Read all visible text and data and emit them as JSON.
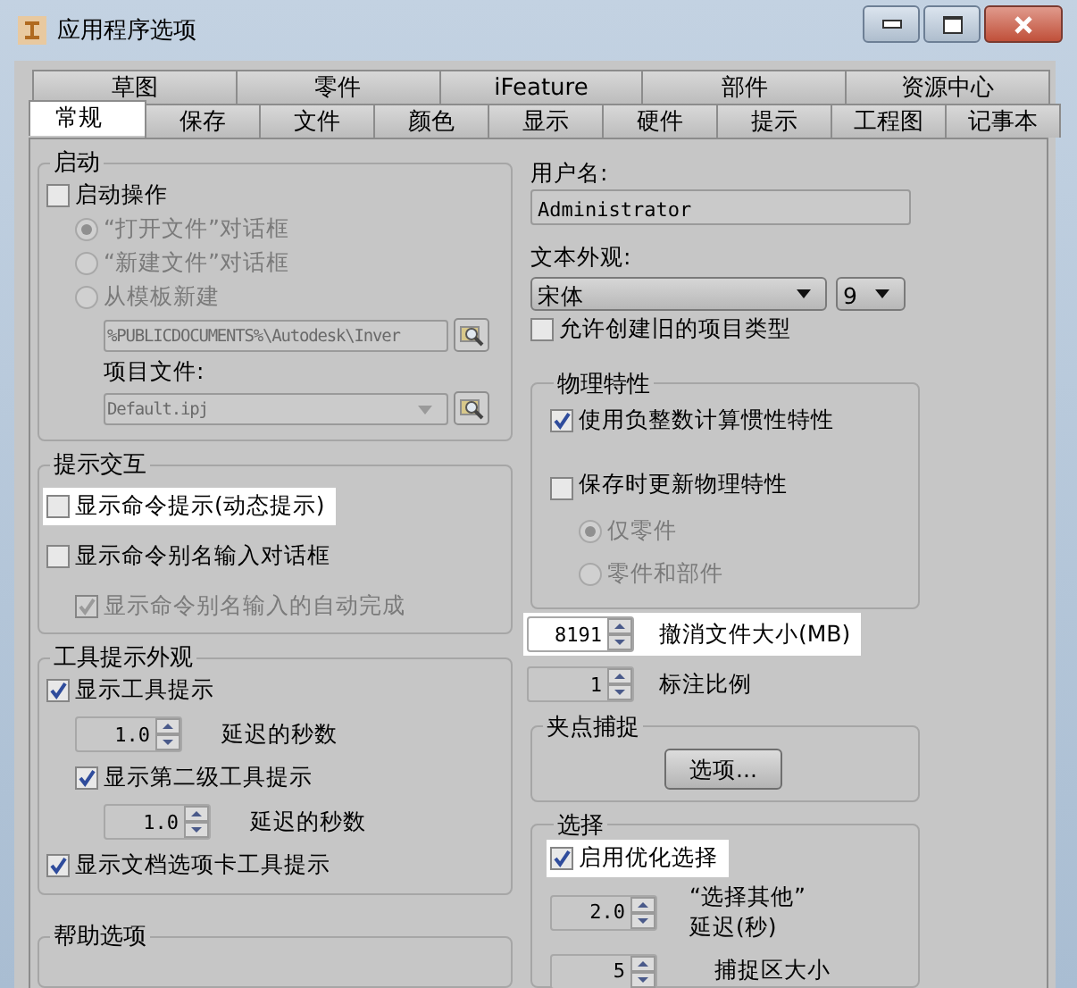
{
  "window": {
    "title": "应用程序选项"
  },
  "tab_rows": [
    [
      {
        "label": "草图",
        "selected": false
      },
      {
        "label": "零件",
        "selected": false
      },
      {
        "label": "iFeature",
        "selected": false
      },
      {
        "label": "部件",
        "selected": false
      },
      {
        "label": "资源中心",
        "selected": false
      }
    ],
    [
      {
        "label": "常规",
        "selected": true
      },
      {
        "label": "保存",
        "selected": false
      },
      {
        "label": "文件",
        "selected": false
      },
      {
        "label": "颜色",
        "selected": false
      },
      {
        "label": "显示",
        "selected": false
      },
      {
        "label": "硬件",
        "selected": false
      },
      {
        "label": "提示",
        "selected": false
      },
      {
        "label": "工程图",
        "selected": false
      },
      {
        "label": "记事本",
        "selected": false
      }
    ]
  ],
  "startup": {
    "title": "启动",
    "launch": {
      "label": "启动操作",
      "checked": false
    },
    "options": [
      {
        "label": "“打开文件”对话框",
        "selected": true,
        "disabled": true
      },
      {
        "label": "“新建文件”对话框",
        "selected": false,
        "disabled": true
      },
      {
        "label": "从模板新建",
        "selected": false,
        "disabled": true
      }
    ],
    "template_path": "%PUBLICDOCUMENTS%\\Autodesk\\Inver",
    "project_label": "项目文件:",
    "project_file": "Default.ipj"
  },
  "prompt_interaction": {
    "title": "提示交互",
    "items": [
      {
        "label": "显示命令提示(动态提示)",
        "checked": false,
        "disabled": false,
        "highlighted": true
      },
      {
        "label": "显示命令别名输入对话框",
        "checked": false,
        "disabled": false,
        "highlighted": false,
        "children": [
          {
            "label": "显示命令别名输入的自动完成",
            "checked": true,
            "disabled": true,
            "highlighted": false
          }
        ]
      }
    ]
  },
  "tooltip_appearance": {
    "title": "工具提示外观",
    "show_tooltips": {
      "label": "显示工具提示",
      "checked": true
    },
    "delay": {
      "value": "1.0",
      "label": "延迟的秒数"
    },
    "second_level": {
      "label": "显示第二级工具提示",
      "checked": true
    },
    "second_delay": {
      "value": "1.0",
      "label": "延迟的秒数"
    },
    "doc_tab_tooltips": {
      "label": "显示文档选项卡工具提示",
      "checked": true
    }
  },
  "help_options": {
    "title": "帮助选项"
  },
  "username": {
    "label": "用户名:",
    "value": "Administrator"
  },
  "text_appearance": {
    "label": "文本外观:",
    "font": "宋体",
    "size": "9"
  },
  "allow_legacy": {
    "label": "允许创建旧的项目类型",
    "checked": false
  },
  "physical": {
    "title": "物理特性",
    "use_negative": {
      "label": "使用负整数计算惯性特性",
      "checked": true
    },
    "update_on_save": {
      "label": "保存时更新物理特性",
      "checked": false
    },
    "options": [
      {
        "label": "仅零件",
        "selected": true,
        "disabled": true
      },
      {
        "label": "零件和部件",
        "selected": false,
        "disabled": true
      }
    ]
  },
  "undo_size": {
    "value": "8191",
    "label": "撤消文件大小(MB)",
    "highlighted": true
  },
  "annotation_scale": {
    "value": "1",
    "label": "标注比例",
    "highlighted": false
  },
  "grip_snap": {
    "title": "夹点捕捉",
    "button": "选项..."
  },
  "selection": {
    "title": "选择",
    "optimize": {
      "label": "启用优化选择",
      "checked": true,
      "highlighted": true
    },
    "select_other_delay": {
      "value": "2.0",
      "label_lines": [
        "“选择其他”",
        "延迟(秒)"
      ]
    },
    "pick_box": {
      "value": "5",
      "label": "捕捉区大小"
    }
  }
}
